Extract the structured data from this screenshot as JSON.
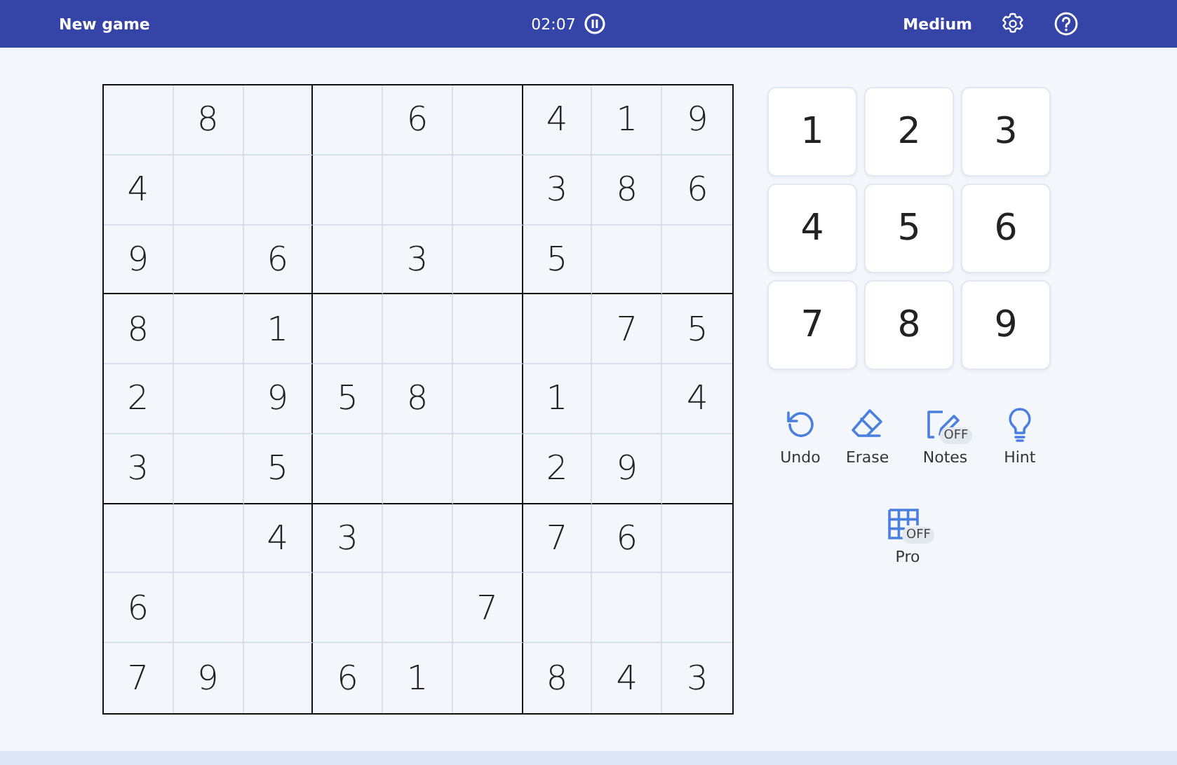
{
  "header": {
    "new_game": "New game",
    "timer": "02:07",
    "difficulty": "Medium"
  },
  "board": [
    [
      {
        "kind": "blank"
      },
      {
        "kind": "given",
        "value": "8"
      },
      {
        "kind": "blank"
      },
      {
        "kind": "blank"
      },
      {
        "kind": "given",
        "value": "6"
      },
      {
        "kind": "blank"
      },
      {
        "kind": "given",
        "value": "4"
      },
      {
        "kind": "given",
        "value": "1"
      },
      {
        "kind": "given",
        "value": "9"
      }
    ],
    [
      {
        "kind": "given",
        "value": "4"
      },
      {
        "kind": "blank"
      },
      {
        "kind": "blank"
      },
      {
        "kind": "blank"
      },
      {
        "kind": "blank"
      },
      {
        "kind": "blank"
      },
      {
        "kind": "given",
        "value": "3"
      },
      {
        "kind": "given",
        "value": "8"
      },
      {
        "kind": "given",
        "value": "6"
      }
    ],
    [
      {
        "kind": "given",
        "value": "9"
      },
      {
        "kind": "blank"
      },
      {
        "kind": "given",
        "value": "6"
      },
      {
        "kind": "blank"
      },
      {
        "kind": "given",
        "value": "3"
      },
      {
        "kind": "blank"
      },
      {
        "kind": "given",
        "value": "5"
      },
      {
        "kind": "blank"
      },
      {
        "kind": "blank"
      }
    ],
    [
      {
        "kind": "given",
        "value": "8"
      },
      {
        "kind": "blank"
      },
      {
        "kind": "given",
        "value": "1"
      },
      {
        "kind": "blank"
      },
      {
        "kind": "blank"
      },
      {
        "kind": "blank"
      },
      {
        "kind": "blank"
      },
      {
        "kind": "given",
        "value": "7"
      },
      {
        "kind": "given",
        "value": "5"
      }
    ],
    [
      {
        "kind": "given",
        "value": "2"
      },
      {
        "kind": "blank"
      },
      {
        "kind": "given",
        "value": "9"
      },
      {
        "kind": "given",
        "value": "5"
      },
      {
        "kind": "given",
        "value": "8"
      },
      {
        "kind": "blank"
      },
      {
        "kind": "given",
        "value": "1"
      },
      {
        "kind": "blank"
      },
      {
        "kind": "given",
        "value": "4"
      }
    ],
    [
      {
        "kind": "given",
        "value": "3"
      },
      {
        "kind": "blank"
      },
      {
        "kind": "given",
        "value": "5"
      },
      {
        "kind": "blank"
      },
      {
        "kind": "blank"
      },
      {
        "kind": "blank"
      },
      {
        "kind": "given",
        "value": "2"
      },
      {
        "kind": "given",
        "value": "9"
      },
      {
        "kind": "blank"
      }
    ],
    [
      {
        "kind": "blank"
      },
      {
        "kind": "blank"
      },
      {
        "kind": "given",
        "value": "4"
      },
      {
        "kind": "given",
        "value": "3"
      },
      {
        "kind": "blank"
      },
      {
        "kind": "blank"
      },
      {
        "kind": "given",
        "value": "7"
      },
      {
        "kind": "given",
        "value": "6"
      },
      {
        "kind": "blank"
      }
    ],
    [
      {
        "kind": "given",
        "value": "6"
      },
      {
        "kind": "blank"
      },
      {
        "kind": "blank"
      },
      {
        "kind": "blank"
      },
      {
        "kind": "blank"
      },
      {
        "kind": "given",
        "value": "7"
      },
      {
        "kind": "blank"
      },
      {
        "kind": "blank"
      },
      {
        "kind": "blank"
      }
    ],
    [
      {
        "kind": "given",
        "value": "7"
      },
      {
        "kind": "given",
        "value": "9"
      },
      {
        "kind": "blank"
      },
      {
        "kind": "given",
        "value": "6"
      },
      {
        "kind": "given",
        "value": "1"
      },
      {
        "kind": "blank"
      },
      {
        "kind": "given",
        "value": "8"
      },
      {
        "kind": "given",
        "value": "4"
      },
      {
        "kind": "given",
        "value": "3"
      }
    ]
  ],
  "numpad": [
    "1",
    "2",
    "3",
    "4",
    "5",
    "6",
    "7",
    "8",
    "9"
  ],
  "tools": [
    {
      "kind": "undo",
      "label": "Undo"
    },
    {
      "kind": "erase",
      "label": "Erase"
    },
    {
      "kind": "notes",
      "label": "Notes",
      "badge": "OFF"
    },
    {
      "kind": "hint",
      "label": "Hint"
    }
  ],
  "pro": {
    "kind": "pro",
    "label": "Pro",
    "badge": "OFF"
  }
}
